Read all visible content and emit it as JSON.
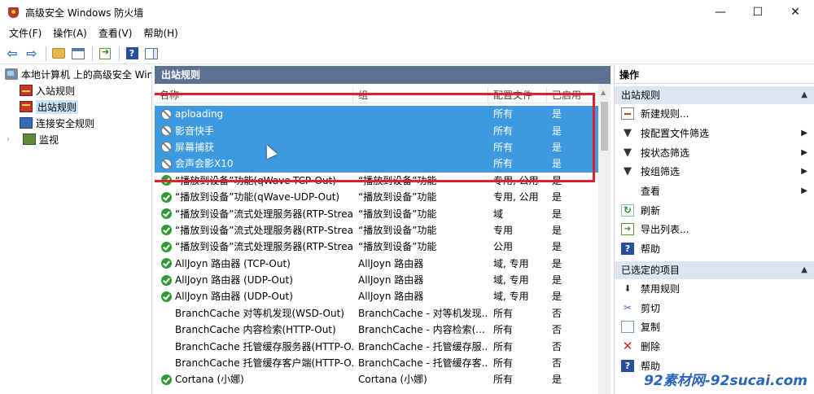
{
  "window": {
    "title": "高级安全 Windows 防火墙",
    "minimize": "—",
    "maximize": "☐",
    "close": "✕"
  },
  "menu": [
    "文件(F)",
    "操作(A)",
    "查看(V)",
    "帮助(H)"
  ],
  "tree": {
    "root": "本地计算机 上的高级安全 Windows",
    "items": [
      "入站规则",
      "出站规则",
      "连接安全规则",
      "监视"
    ],
    "selected": "出站规则"
  },
  "center": {
    "header": "出站规则",
    "columns": [
      "名称",
      "组",
      "配置文件",
      "已启用"
    ],
    "rows": [
      {
        "icon": "block",
        "name": "aploading",
        "group": "",
        "profile": "所有",
        "enabled": "是",
        "selected": true
      },
      {
        "icon": "block",
        "name": "影音快手",
        "group": "",
        "profile": "所有",
        "enabled": "是",
        "selected": true
      },
      {
        "icon": "block",
        "name": "屏幕捕获",
        "group": "",
        "profile": "所有",
        "enabled": "是",
        "selected": true
      },
      {
        "icon": "block",
        "name": "会声会影X10",
        "group": "",
        "profile": "所有",
        "enabled": "是",
        "selected": true
      },
      {
        "icon": "allow",
        "name": "“播放到设备”功能(qWave-TCP-Out)",
        "group": "“播放到设备”功能",
        "profile": "专用, 公用",
        "enabled": "是"
      },
      {
        "icon": "allow",
        "name": "“播放到设备”功能(qWave-UDP-Out)",
        "group": "“播放到设备”功能",
        "profile": "专用, 公用",
        "enabled": "是"
      },
      {
        "icon": "allow",
        "name": "“播放到设备”流式处理服务器(RTP-Strea...",
        "group": "“播放到设备”功能",
        "profile": "域",
        "enabled": "是"
      },
      {
        "icon": "allow",
        "name": "“播放到设备”流式处理服务器(RTP-Strea...",
        "group": "“播放到设备”功能",
        "profile": "专用",
        "enabled": "是"
      },
      {
        "icon": "allow",
        "name": "“播放到设备”流式处理服务器(RTP-Strea...",
        "group": "“播放到设备”功能",
        "profile": "公用",
        "enabled": "是"
      },
      {
        "icon": "allow",
        "name": "AllJoyn 路由器 (TCP-Out)",
        "group": "AllJoyn 路由器",
        "profile": "域, 专用",
        "enabled": "是"
      },
      {
        "icon": "allow",
        "name": "AllJoyn 路由器 (UDP-Out)",
        "group": "AllJoyn 路由器",
        "profile": "域, 专用",
        "enabled": "是"
      },
      {
        "icon": "allow",
        "name": "AllJoyn 路由器 (UDP-Out)",
        "group": "AllJoyn 路由器",
        "profile": "域, 专用",
        "enabled": "是"
      },
      {
        "icon": "none",
        "name": "BranchCache 对等机发现(WSD-Out)",
        "group": "BranchCache - 对等机发现...",
        "profile": "所有",
        "enabled": "否"
      },
      {
        "icon": "none",
        "name": "BranchCache 内容检索(HTTP-Out)",
        "group": "BranchCache - 内容检索(...",
        "profile": "所有",
        "enabled": "否"
      },
      {
        "icon": "none",
        "name": "BranchCache 托管缓存服务器(HTTP-O...",
        "group": "BranchCache - 托管缓存服...",
        "profile": "所有",
        "enabled": "否"
      },
      {
        "icon": "none",
        "name": "BranchCache 托管缓存客户端(HTTP-O...",
        "group": "BranchCache - 托管缓存客...",
        "profile": "所有",
        "enabled": "否"
      },
      {
        "icon": "allow",
        "name": "Cortana (小娜)",
        "group": "Cortana (小娜)",
        "profile": "所有",
        "enabled": "是"
      }
    ]
  },
  "actions": {
    "title": "操作",
    "section1": "出站规则",
    "section1_items": [
      {
        "label": "新建规则...",
        "icon": "rule",
        "more": false
      },
      {
        "label": "按配置文件筛选",
        "icon": "filter",
        "more": true
      },
      {
        "label": "按状态筛选",
        "icon": "filter",
        "more": true
      },
      {
        "label": "按组筛选",
        "icon": "filter",
        "more": true
      },
      {
        "label": "查看",
        "icon": "none",
        "more": true
      },
      {
        "label": "刷新",
        "icon": "refresh",
        "more": false
      },
      {
        "label": "导出列表...",
        "icon": "exportx",
        "more": false
      },
      {
        "label": "帮助",
        "icon": "helpx",
        "more": false
      }
    ],
    "section2": "已选定的项目",
    "section2_items": [
      {
        "label": "禁用规则",
        "icon": "disable"
      },
      {
        "label": "剪切",
        "icon": "cut"
      },
      {
        "label": "复制",
        "icon": "copy"
      },
      {
        "label": "删除",
        "icon": "del"
      },
      {
        "label": "帮助",
        "icon": "helpx"
      }
    ]
  },
  "watermark": "92素材网-92sucai.com"
}
